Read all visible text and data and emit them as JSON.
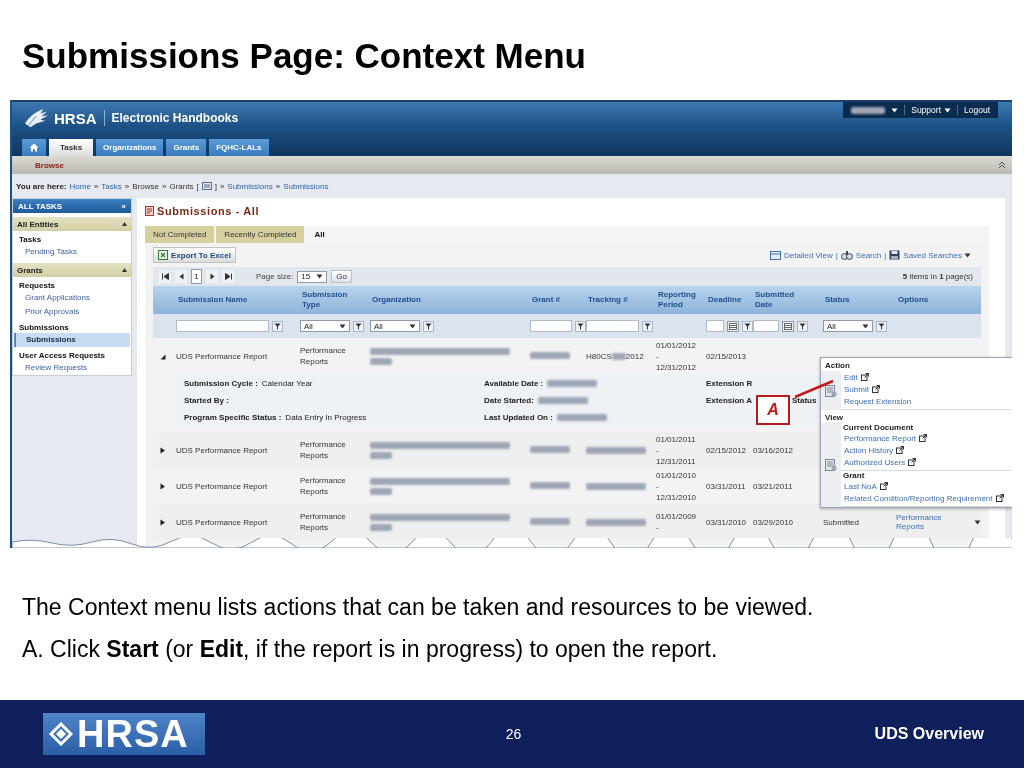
{
  "slide_title": "Submissions Page: Context Menu",
  "app": {
    "brand": "HRSA",
    "title": "Electronic Handbooks",
    "user_menu": [
      {
        "label": "Support",
        "dropdown": true
      },
      {
        "label": "Logout",
        "dropdown": false
      }
    ],
    "tabs": [
      {
        "label": "Tasks",
        "selected": true
      },
      {
        "label": "Organizations",
        "selected": false
      },
      {
        "label": "Grants",
        "selected": false
      },
      {
        "label": "FQHC-LALs",
        "selected": false
      }
    ],
    "subnav": "Browse",
    "breadcrumb": {
      "label": "You are here:",
      "separator": "»",
      "items": [
        {
          "text": "Home",
          "link": true
        },
        {
          "text": "Tasks",
          "link": true
        },
        {
          "text": "Browse",
          "link": false
        },
        {
          "text": "Grants",
          "link": false,
          "open": "[",
          "close": "]"
        },
        {
          "text": "Submissions",
          "link": true
        },
        {
          "text": "Submissions",
          "link": true
        }
      ]
    }
  },
  "sidebar": {
    "title": "ALL TASKS",
    "collapse": "«",
    "sections": [
      {
        "title": "All Entities",
        "groups": [
          {
            "title": "Tasks",
            "items": [
              {
                "label": "Pending Tasks",
                "selected": false
              }
            ]
          }
        ]
      },
      {
        "title": "Grants",
        "groups": [
          {
            "title": "Requests",
            "items": [
              {
                "label": "Grant Applications",
                "selected": false
              },
              {
                "label": "Prior Approvals",
                "selected": false
              }
            ]
          },
          {
            "title": "Submissions",
            "items": [
              {
                "label": "Submissions",
                "selected": true
              }
            ]
          },
          {
            "title": "User Access Requests",
            "items": [
              {
                "label": "Review Requests",
                "selected": false
              }
            ]
          }
        ]
      }
    ]
  },
  "page": {
    "title": "Submissions - All",
    "tabs": [
      {
        "label": "Not Completed",
        "selected": false
      },
      {
        "label": "Recently Completed",
        "selected": false
      },
      {
        "label": "All",
        "selected": true
      }
    ],
    "export": "Export To Excel",
    "link_separator": "|",
    "links": [
      {
        "label": "Detailed View",
        "dropdown": false
      },
      {
        "label": "Search",
        "dropdown": false
      },
      {
        "label": "Saved Searches",
        "dropdown": true
      }
    ],
    "pager": {
      "page": "1",
      "size_label": "Page size:",
      "size": "15",
      "go": "Go",
      "summary": "**5** items in **1** page(s)"
    }
  },
  "table": {
    "columns": [
      "Submission Name",
      "Submission Type",
      "Organization",
      "Grant #",
      "Tracking #",
      "Reporting Period",
      "Deadline",
      "Submitted Date",
      "Status",
      "Options"
    ],
    "filters": [
      {
        "kind": "text"
      },
      {
        "kind": "select",
        "value": "All"
      },
      {
        "kind": "select",
        "value": "All"
      },
      {
        "kind": "text"
      },
      {
        "kind": "text"
      },
      {
        "kind": "none"
      },
      {
        "kind": "date"
      },
      {
        "kind": "date"
      },
      {
        "kind": "select",
        "value": "All"
      },
      {
        "kind": "none"
      }
    ],
    "rows": [
      {
        "expanded": true,
        "name": "UDS Performance Report",
        "type": "Performance Reports",
        "tracking_prefix": "H80CS",
        "tracking_suffix": "2012",
        "period": [
          "01/01/2012",
          "-",
          "12/31/2012"
        ],
        "deadline": "02/15/2013",
        "details": [
          [
            {
              "label": "Submission Cycle :",
              "value": "Calendar Year",
              "blurred": false
            },
            {
              "label": "Started By :",
              "blurred": false
            },
            {
              "label": "Program Specific Status :",
              "value": "Data Entry In Progress",
              "blurred": false
            }
          ],
          [
            {
              "label": "Available Date :",
              "blurred": true
            },
            {
              "label": "Date Started:",
              "blurred": true
            },
            {
              "label": "Last Updated On :",
              "blurred": true
            }
          ],
          [
            {
              "label": "Extension R",
              "blurred": false
            },
            {
              "label": "Extension A",
              "tail": "Status",
              "blurred": false
            }
          ]
        ]
      },
      {
        "expanded": false,
        "name": "UDS Performance Report",
        "type": "Performance Reports",
        "period": [
          "01/01/2011",
          "-",
          "12/31/2011"
        ],
        "deadline": "02/15/2012",
        "submitted": "03/16/2012"
      },
      {
        "expanded": false,
        "name": "UDS Performance Report",
        "type": "Performance Reports",
        "period": [
          "01/01/2010",
          "-",
          "12/31/2010"
        ],
        "deadline": "03/31/2011",
        "submitted": "03/21/2011"
      },
      {
        "expanded": false,
        "name": "UDS Performance Report",
        "type": "Performance Reports",
        "period": [
          "01/01/2009",
          "-"
        ],
        "deadline": "03/31/2010",
        "submitted": "03/29/2010",
        "status": "Submitted",
        "options": "Performance Reports"
      }
    ]
  },
  "context_menu": {
    "sections": [
      {
        "title": "Action",
        "groups": [
          {
            "items": [
              {
                "label": "Edit",
                "external": true
              },
              {
                "label": "Submit",
                "external": true
              },
              {
                "label": "Request Extension",
                "external": false
              }
            ]
          }
        ]
      },
      {
        "title": "View",
        "groups": [
          {
            "title": "Current Document",
            "items": [
              {
                "label": "Performance Report",
                "external": true
              },
              {
                "label": "Action History",
                "external": true
              },
              {
                "label": "Authorized Users",
                "external": true
              }
            ]
          },
          {
            "title": "Grant",
            "items": [
              {
                "label": "Last NoA",
                "external": true
              },
              {
                "label": "Related Condition/Reporting Requirement",
                "external": true
              }
            ]
          }
        ]
      }
    ]
  },
  "callout": "A",
  "caption": [
    "The Context menu lists actions that can be taken and resources to be viewed.",
    "A. Click **Start** (or **Edit**, if the report is in progress) to open the report."
  ],
  "footer": {
    "logo": "HRSA",
    "page": "26",
    "title": "UDS Overview"
  }
}
